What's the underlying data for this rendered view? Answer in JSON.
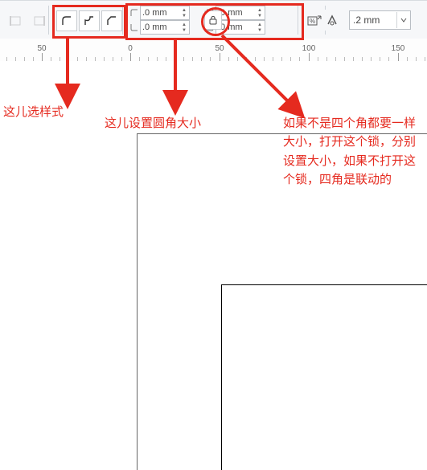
{
  "toolbar": {
    "corner_values": {
      "top_left": ".0 mm",
      "bottom_left": ".0 mm",
      "top_right": ".0 mm",
      "bottom_right": ".0 mm"
    },
    "outline_width_value": ".2 mm"
  },
  "ruler": {
    "labels": [
      "50",
      "0",
      "50",
      "100",
      "150"
    ]
  },
  "annotations": {
    "style_here": "这儿选样式",
    "radius_here": "这儿设置圆角大小",
    "lock_note": "如果不是四个角都要一样大小，打开这个锁，分别设置大小，如果不打开这个锁，四角是联动的"
  },
  "colors": {
    "highlight": "#e52a1f"
  }
}
